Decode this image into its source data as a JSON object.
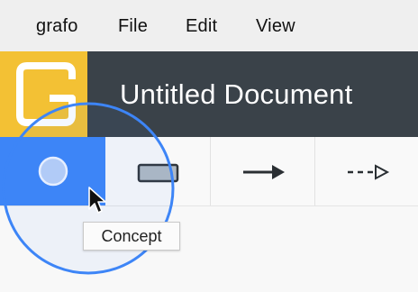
{
  "menu": {
    "items": [
      "grafo",
      "File",
      "Edit",
      "View"
    ]
  },
  "header": {
    "title": "Untitled Document"
  },
  "toolbar": {
    "tools": [
      {
        "name": "concept",
        "icon": "circle-icon",
        "selected": true
      },
      {
        "name": "rectangle",
        "icon": "rectangle-icon",
        "selected": false
      },
      {
        "name": "arrow",
        "icon": "arrow-icon",
        "selected": false
      },
      {
        "name": "dashed-arrow",
        "icon": "dashed-arrow-icon",
        "selected": false
      }
    ]
  },
  "tooltip": {
    "text": "Concept"
  },
  "colors": {
    "menubar_bg": "#efefef",
    "header_bg": "#3a4249",
    "logo_yellow": "#f3c134",
    "selected_tool": "#3d85f7",
    "magnifier_ring": "#3d85f7"
  }
}
